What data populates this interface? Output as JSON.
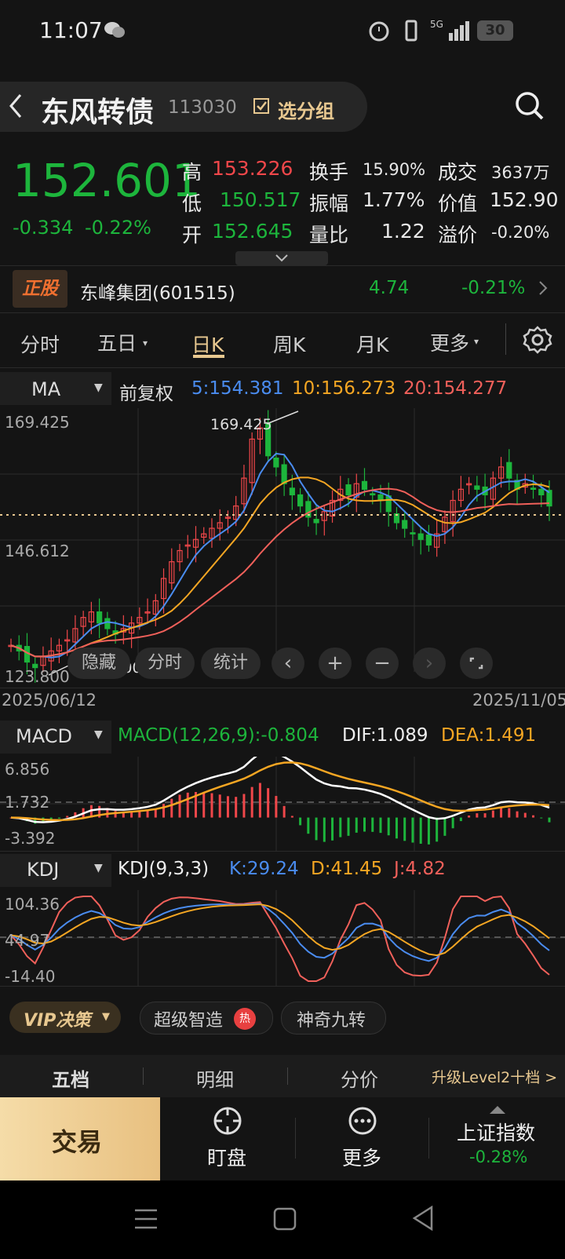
{
  "status": {
    "time": "11:07",
    "network": "5G",
    "battery": "30"
  },
  "header": {
    "name": "东风转债",
    "code": "113030",
    "group_label": "选分组"
  },
  "quote": {
    "price": "152.601",
    "change": "-0.334",
    "change_pct": "-0.22%",
    "high_label": "高",
    "high": "153.226",
    "low_label": "低",
    "low": "150.517",
    "open_label": "开",
    "open": "152.645",
    "turnover_label": "换手",
    "turnover": "15.90%",
    "amplitude_label": "振幅",
    "amplitude": "1.77%",
    "volume_ratio_label": "量比",
    "volume_ratio": "1.22",
    "deal_label": "成交",
    "deal": "3637万",
    "value_label": "价值",
    "value": "152.90",
    "premium_label": "溢价",
    "premium": "-0.20%"
  },
  "stock": {
    "badge": "正股",
    "name": "东峰集团(601515)",
    "price": "4.74",
    "change_pct": "-0.21%"
  },
  "tabs": [
    "分时",
    "五日",
    "日K",
    "周K",
    "月K",
    "更多"
  ],
  "ma": {
    "selector": "MA",
    "adjust": "前复权",
    "ma5": "5:154.381",
    "ma10": "10:156.273",
    "ma20": "20:154.277"
  },
  "kchart": {
    "y_top": "169.425",
    "y_mid": "146.612",
    "y_bottom": "123.800",
    "max_label": "169.425",
    "min_label": "123.800",
    "date_start": "2025/06/12",
    "date_end": "2025/11/05",
    "btn_hide": "隐藏",
    "btn_time": "分时",
    "btn_stats": "统计"
  },
  "macd": {
    "selector": "MACD",
    "title": "MACD(12,26,9):-0.804",
    "dif": "DIF:1.089",
    "dea": "DEA:1.491",
    "y_top": "6.856",
    "y_mid": "1.732",
    "y_bottom": "-3.392"
  },
  "kdj": {
    "selector": "KDJ",
    "title": "KDJ(9,3,3)",
    "k": "K:29.24",
    "d": "D:41.45",
    "j": "J:4.82",
    "y_top": "104.36",
    "y_mid": "44.97",
    "y_bottom": "-14.40"
  },
  "features": {
    "vip": "VIP决策",
    "smart": "超级智造",
    "hot": "热",
    "nine": "神奇九转"
  },
  "bottom_tabs": {
    "five": "五档",
    "detail": "明细",
    "price": "分价",
    "upgrade": "升级Level2十档 >"
  },
  "bottom_nav": {
    "trade": "交易",
    "watch": "盯盘",
    "more": "更多",
    "index_name": "上证指数",
    "index_pct": "-0.28%"
  },
  "colors": {
    "up": "#f0474a",
    "down": "#1db53c",
    "ma5": "#4a8cf0",
    "ma10": "#f5a623",
    "ma20": "#f0605a",
    "gold": "#e8c890"
  },
  "chart_data": {
    "type": "candlestick",
    "y_range": [
      123.8,
      169.425
    ],
    "x_range": [
      "2025/06/12",
      "2025/11/05"
    ],
    "closes": [
      128,
      127,
      125,
      124,
      126,
      127,
      128,
      129,
      131,
      133,
      134,
      132,
      131,
      130,
      131,
      132,
      133,
      134,
      136,
      140,
      143,
      145,
      146,
      147,
      148,
      149,
      150,
      151,
      153,
      158,
      165,
      167,
      162,
      160,
      157,
      155,
      153,
      151,
      150,
      152,
      154,
      156,
      155,
      157,
      156,
      155,
      154,
      152,
      150,
      149,
      148,
      147,
      146,
      148,
      151,
      154,
      156,
      157,
      156,
      155,
      158,
      160,
      158,
      156,
      157,
      156,
      155,
      153
    ],
    "macd_range": [
      -3.392,
      6.856
    ],
    "kdj_range": [
      -14.4,
      104.36
    ]
  }
}
